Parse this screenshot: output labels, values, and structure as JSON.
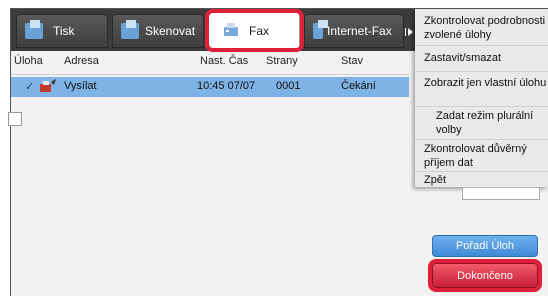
{
  "tabs": [
    {
      "label": "Tisk",
      "icon": "print-icon"
    },
    {
      "label": "Skenovat",
      "icon": "scan-icon"
    },
    {
      "label": "Fax",
      "icon": "fax-icon"
    },
    {
      "label": "Internet-Fax",
      "icon": "internet-fax-icon"
    }
  ],
  "table": {
    "headers": [
      "Úloha",
      "Adresa",
      "Nast. Čas",
      "Strany",
      "Stav"
    ],
    "rows": [
      {
        "address": "Vysílat",
        "time": "10:45 07/07",
        "pages": "0001",
        "status": "Čekání"
      }
    ]
  },
  "menu": {
    "items": [
      "Zkontrolovat podrobnosti zvolené úlohy",
      "Zastavit/smazat",
      "Zobrazit jen vlastní úlohu",
      "Zadat režim plurální volby",
      "Zkontrolovat důvěrný příjem dat",
      "Zpět"
    ]
  },
  "buttons": {
    "job_order": "Pořadí Úloh",
    "done": "Dokončeno"
  },
  "colors": {
    "selected_row": "#7fb2e5",
    "highlight": "#e0203a",
    "done_button": "#c81e36",
    "job_order_button": "#3f8ad6"
  }
}
